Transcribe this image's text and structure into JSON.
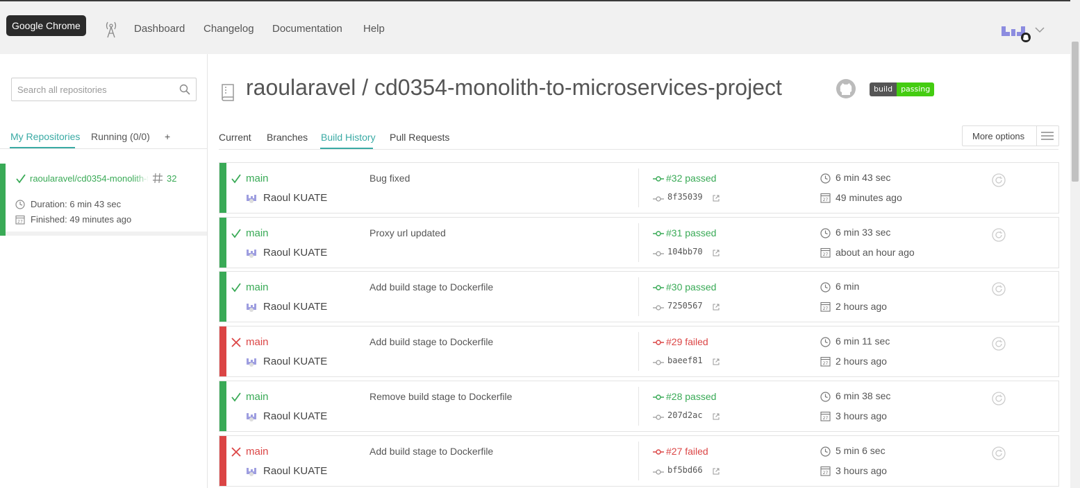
{
  "browser": {
    "tooltip": "Google Chrome"
  },
  "nav": {
    "items": [
      {
        "label": "Dashboard"
      },
      {
        "label": "Changelog"
      },
      {
        "label": "Documentation"
      },
      {
        "label": "Help"
      }
    ]
  },
  "sidebar": {
    "search_placeholder": "Search all repositories",
    "tabs": [
      {
        "label": "My Repositories",
        "active": true
      },
      {
        "label": "Running (0/0)",
        "active": false
      },
      {
        "label": "+",
        "active": false
      }
    ],
    "repo": {
      "name": "raoularavel/cd0354-monolith-to-microservices-project",
      "build_number": "32",
      "duration": "Duration: 6 min 43 sec",
      "finished": "Finished: 49 minutes ago",
      "status": "passed"
    }
  },
  "main": {
    "title": "raoularavel / cd0354-monolith-to-microservices-project",
    "badge": {
      "label": "build",
      "status": "passing"
    },
    "tabs": [
      {
        "label": "Current",
        "active": false
      },
      {
        "label": "Branches",
        "active": false
      },
      {
        "label": "Build History",
        "active": true
      },
      {
        "label": "Pull Requests",
        "active": false
      }
    ],
    "more_options": "More options",
    "builds": [
      {
        "status": "passed",
        "branch": "main",
        "author": "Raoul KUATE",
        "message": "Bug fixed",
        "state": "#32 passed",
        "sha": "8f35039",
        "duration": "6 min 43 sec",
        "finished": "49 minutes ago"
      },
      {
        "status": "passed",
        "branch": "main",
        "author": "Raoul KUATE",
        "message": "Proxy url updated",
        "state": "#31 passed",
        "sha": "104bb70",
        "duration": "6 min 33 sec",
        "finished": "about an hour ago"
      },
      {
        "status": "passed",
        "branch": "main",
        "author": "Raoul KUATE",
        "message": "Add build stage to Dockerfile",
        "state": "#30 passed",
        "sha": "7250567",
        "duration": "6 min",
        "finished": "2 hours ago"
      },
      {
        "status": "failed",
        "branch": "main",
        "author": "Raoul KUATE",
        "message": "Add build stage to Dockerfile",
        "state": "#29 failed",
        "sha": "baeef81",
        "duration": "6 min 11 sec",
        "finished": "2 hours ago"
      },
      {
        "status": "passed",
        "branch": "main",
        "author": "Raoul KUATE",
        "message": "Remove build stage to Dockerfile",
        "state": "#28 passed",
        "sha": "207d2ac",
        "duration": "6 min 38 sec",
        "finished": "3 hours ago"
      },
      {
        "status": "failed",
        "branch": "main",
        "author": "Raoul KUATE",
        "message": "Add build stage to Dockerfile",
        "state": "#27 failed",
        "sha": "bf5bd66",
        "duration": "5 min 6 sec",
        "finished": "3 hours ago"
      }
    ]
  },
  "colors": {
    "passed": "#39aa56",
    "failed": "#db4545",
    "accent": "#39aaa4",
    "badge_passing": "#44cc11"
  },
  "icons": [
    "beacon-icon",
    "search-icon",
    "check-icon",
    "cross-icon",
    "hash-icon",
    "clock-icon",
    "calendar-icon",
    "repo-icon",
    "github-icon",
    "menu-icon",
    "commit-icon",
    "external-link-icon",
    "restart-icon",
    "avatar-icon",
    "chevron-down-icon"
  ]
}
